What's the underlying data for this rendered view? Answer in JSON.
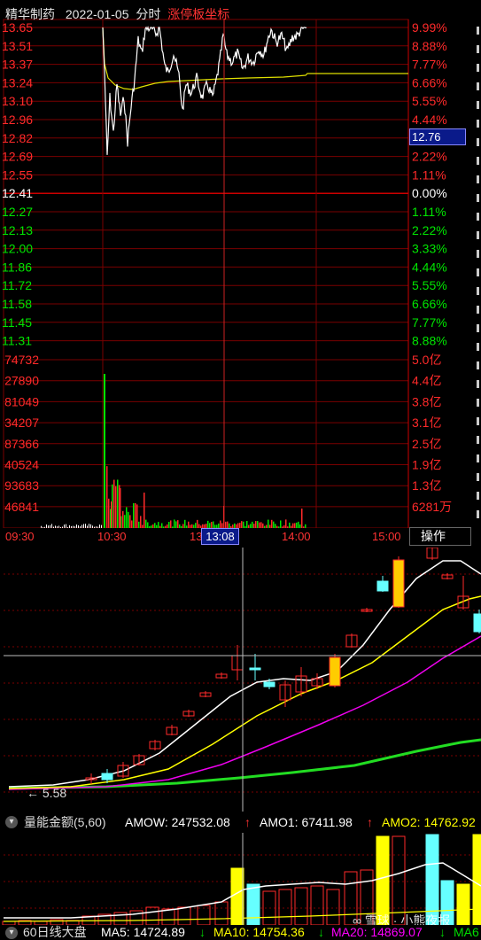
{
  "header": {
    "stock_name": "精华制药",
    "date": "2022-01-05",
    "mode": "分时",
    "coord_mode": "涨停板坐标"
  },
  "colors": {
    "red": "#ff2a2a",
    "green": "#00e600",
    "grid": "#7a0000",
    "white": "#ffffff",
    "yellow": "#ffff00",
    "magenta": "#ff00ff",
    "cyan": "#66ffff"
  },
  "price_axis": {
    "left": [
      "13.65",
      "13.51",
      "13.37",
      "13.24",
      "13.10",
      "12.96",
      "12.82",
      "12.69",
      "12.55",
      "12.41",
      "12.27",
      "12.13",
      "12.00",
      "11.86",
      "11.72",
      "11.58",
      "11.45",
      "11.31"
    ],
    "right": [
      "9.99%",
      "8.88%",
      "7.77%",
      "6.66%",
      "5.55%",
      "4.44%",
      "3.33%",
      "2.22%",
      "1.11%",
      "0.00%",
      "1.11%",
      "2.22%",
      "3.33%",
      "4.44%",
      "5.55%",
      "6.66%",
      "7.77%",
      "8.88%"
    ],
    "current_price": "12.76"
  },
  "volume_axis": {
    "left": [
      "74732",
      "27890",
      "81049",
      "34207",
      "87366",
      "40524",
      "93683",
      "46841"
    ],
    "right": [
      "5.0亿",
      "4.4亿",
      "3.8亿",
      "3.1亿",
      "2.5亿",
      "1.9亿",
      "1.3亿",
      "6281万"
    ]
  },
  "time_axis": {
    "labels": [
      "09:30",
      "10:30",
      "13",
      "14:00",
      "15:00"
    ],
    "cursor_time": "13:08",
    "action_button": "操作"
  },
  "kline_panel": {
    "low_label": "5.58"
  },
  "indicator_bar": {
    "name": "量能金额(5,60)",
    "amow": "AMOW: 247532.08",
    "amo1": "AMO1: 67411.98",
    "amo2": "AMO2: 14762.92"
  },
  "bottom_bar": {
    "name": "60日线大盘",
    "ma5": "MA5: 14724.89",
    "ma10": "MA10: 14754.36",
    "ma20": "MA20: 14869.07",
    "ma60": "MA6"
  },
  "watermark": "雪球 · 小熊夜报"
}
